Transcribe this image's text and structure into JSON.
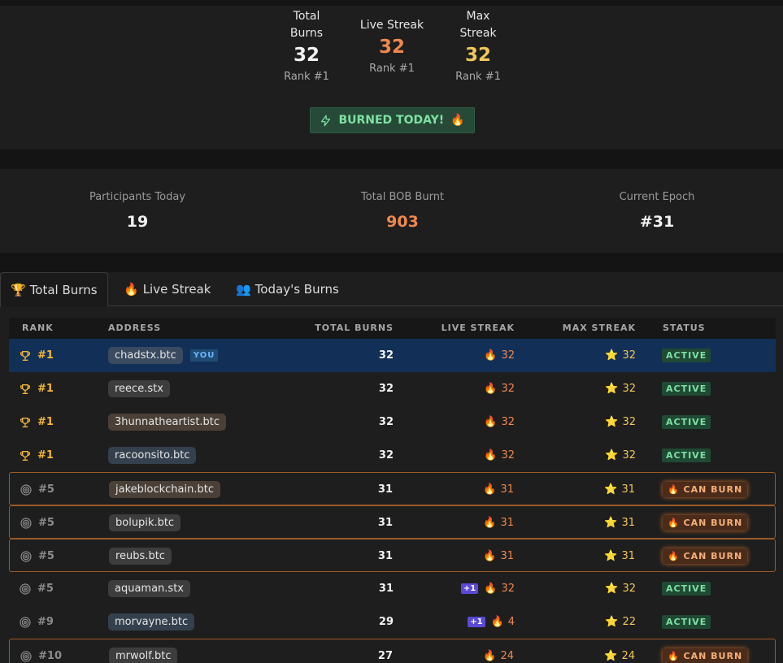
{
  "top_stats": {
    "total_burns": {
      "label_line1": "Total",
      "label_line2": "Burns",
      "value": "32",
      "rank": "Rank #1"
    },
    "live_streak": {
      "label": "Live Streak",
      "value": "32",
      "rank": "Rank #1"
    },
    "max_streak": {
      "label_line1": "Max",
      "label_line2": "Streak",
      "value": "32",
      "rank": "Rank #1"
    },
    "burned_today": "BURNED TODAY!"
  },
  "summary": {
    "participants": {
      "label": "Participants Today",
      "value": "19"
    },
    "bob_burnt": {
      "label": "Total BOB Burnt",
      "value": "903"
    },
    "epoch": {
      "label": "Current Epoch",
      "value": "#31"
    }
  },
  "tabs": [
    {
      "label": "Total Burns",
      "icon": "trophy-icon"
    },
    {
      "label": "Live Streak",
      "icon": "flame-icon"
    },
    {
      "label": "Today's Burns",
      "icon": "people-icon"
    }
  ],
  "table": {
    "headers": {
      "rank": "RANK",
      "address": "ADDRESS",
      "total_burns": "TOTAL BURNS",
      "live_streak": "LIVE STREAK",
      "max_streak": "MAX STREAK",
      "status": "STATUS"
    },
    "you_label": "YOU",
    "rows": [
      {
        "rank": "#1",
        "address": "chadstx.btc",
        "total": "32",
        "live": "32",
        "max": "32",
        "status": "ACTIVE",
        "plus": ""
      },
      {
        "rank": "#1",
        "address": "reece.stx",
        "total": "32",
        "live": "32",
        "max": "32",
        "status": "ACTIVE",
        "plus": ""
      },
      {
        "rank": "#1",
        "address": "3hunnatheartist.btc",
        "total": "32",
        "live": "32",
        "max": "32",
        "status": "ACTIVE",
        "plus": ""
      },
      {
        "rank": "#1",
        "address": "racoonsito.btc",
        "total": "32",
        "live": "32",
        "max": "32",
        "status": "ACTIVE",
        "plus": ""
      },
      {
        "rank": "#5",
        "address": "jakeblockchain.btc",
        "total": "31",
        "live": "31",
        "max": "31",
        "status": "CAN BURN",
        "plus": ""
      },
      {
        "rank": "#5",
        "address": "bolupik.btc",
        "total": "31",
        "live": "31",
        "max": "31",
        "status": "CAN BURN",
        "plus": ""
      },
      {
        "rank": "#5",
        "address": "reubs.btc",
        "total": "31",
        "live": "31",
        "max": "31",
        "status": "CAN BURN",
        "plus": ""
      },
      {
        "rank": "#5",
        "address": "aquaman.stx",
        "total": "31",
        "live": "32",
        "max": "32",
        "status": "ACTIVE",
        "plus": "+1"
      },
      {
        "rank": "#9",
        "address": "morvayne.btc",
        "total": "29",
        "live": "4",
        "max": "22",
        "status": "ACTIVE",
        "plus": "+1"
      },
      {
        "rank": "#10",
        "address": "mrwolf.btc",
        "total": "27",
        "live": "24",
        "max": "24",
        "status": "CAN BURN",
        "plus": ""
      }
    ]
  },
  "colors": {
    "accent_orange": "#f0884d",
    "accent_yellow": "#f0c75a",
    "active_green": "#7fe0a3",
    "you_row": "#123057"
  }
}
